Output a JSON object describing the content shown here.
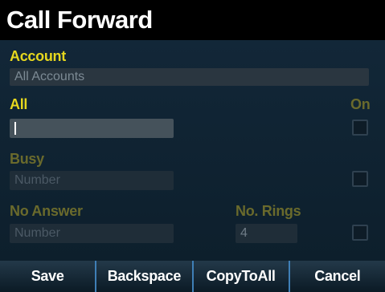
{
  "title": "Call Forward",
  "account": {
    "label": "Account",
    "value": "All Accounts"
  },
  "all": {
    "label": "All",
    "on_label": "On",
    "value": ""
  },
  "busy": {
    "label": "Busy",
    "placeholder": "Number"
  },
  "no_answer": {
    "label": "No Answer",
    "placeholder": "Number",
    "rings_label": "No. Rings",
    "rings_value": "4"
  },
  "softkeys": {
    "save": "Save",
    "backspace": "Backspace",
    "copy_to_all": "CopyToAll",
    "cancel": "Cancel"
  }
}
